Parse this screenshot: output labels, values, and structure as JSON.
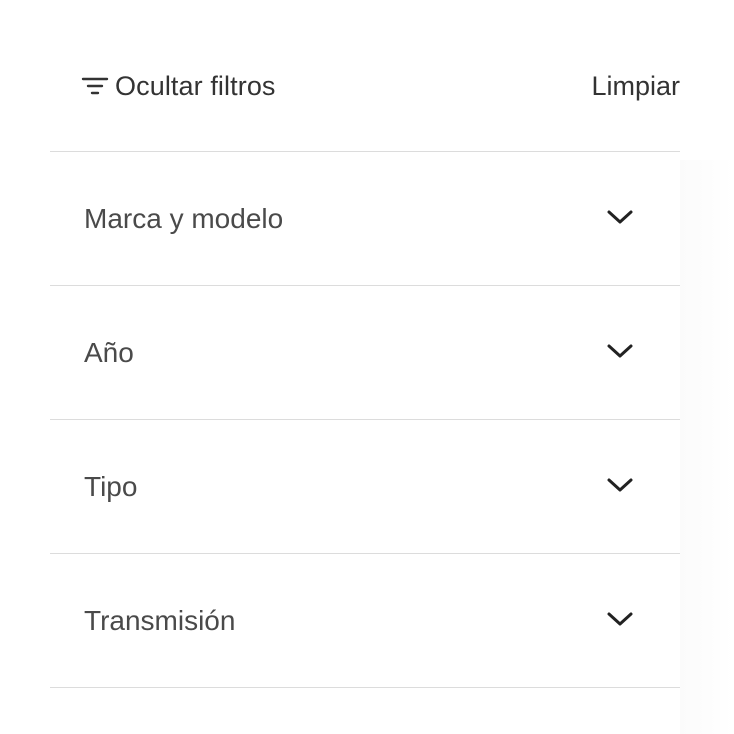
{
  "header": {
    "hide_filters_label": "Ocultar filtros",
    "clear_label": "Limpiar",
    "filter_icon": "filter-lines-icon"
  },
  "filters": {
    "items": [
      {
        "label": "Marca y modelo",
        "icon": "chevron-down-icon"
      },
      {
        "label": "Año",
        "icon": "chevron-down-icon"
      },
      {
        "label": "Tipo",
        "icon": "chevron-down-icon"
      },
      {
        "label": "Transmisión",
        "icon": "chevron-down-icon"
      }
    ]
  },
  "colors": {
    "text": "#333333",
    "label": "#4a4a4a",
    "divider": "#dcdcdc",
    "background": "#ffffff"
  }
}
